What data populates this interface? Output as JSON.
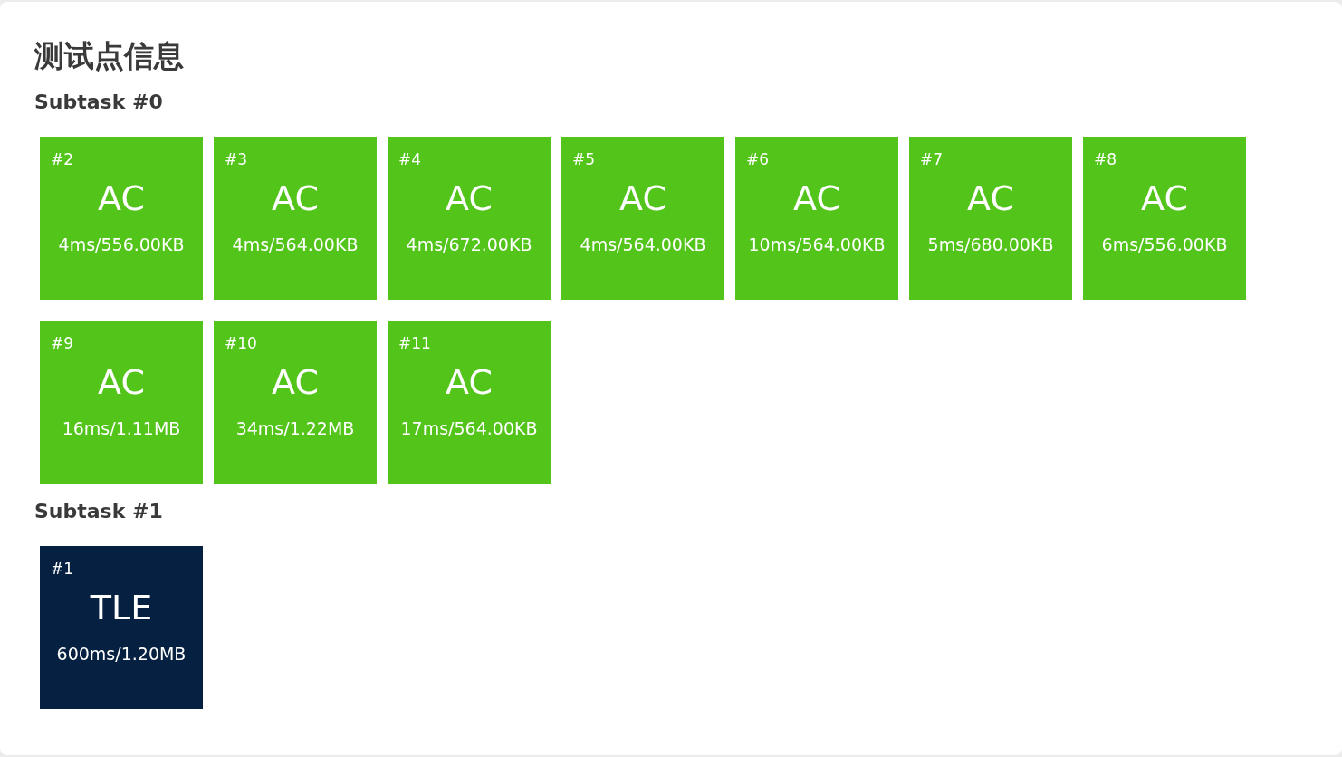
{
  "title": "测试点信息",
  "subtasks": [
    {
      "title": "Subtask #0",
      "cases": [
        {
          "number": "#2",
          "verdict": "AC",
          "usage": "4ms/556.00KB",
          "color": "#52c41a"
        },
        {
          "number": "#3",
          "verdict": "AC",
          "usage": "4ms/564.00KB",
          "color": "#52c41a"
        },
        {
          "number": "#4",
          "verdict": "AC",
          "usage": "4ms/672.00KB",
          "color": "#52c41a"
        },
        {
          "number": "#5",
          "verdict": "AC",
          "usage": "4ms/564.00KB",
          "color": "#52c41a"
        },
        {
          "number": "#6",
          "verdict": "AC",
          "usage": "10ms/564.00KB",
          "color": "#52c41a"
        },
        {
          "number": "#7",
          "verdict": "AC",
          "usage": "5ms/680.00KB",
          "color": "#52c41a"
        },
        {
          "number": "#8",
          "verdict": "AC",
          "usage": "6ms/556.00KB",
          "color": "#52c41a"
        },
        {
          "number": "#9",
          "verdict": "AC",
          "usage": "16ms/1.11MB",
          "color": "#52c41a"
        },
        {
          "number": "#10",
          "verdict": "AC",
          "usage": "34ms/1.22MB",
          "color": "#52c41a"
        },
        {
          "number": "#11",
          "verdict": "AC",
          "usage": "17ms/564.00KB",
          "color": "#52c41a"
        }
      ]
    },
    {
      "title": "Subtask #1",
      "cases": [
        {
          "number": "#1",
          "verdict": "TLE",
          "usage": "600ms/1.20MB",
          "color": "#052041"
        }
      ]
    }
  ]
}
